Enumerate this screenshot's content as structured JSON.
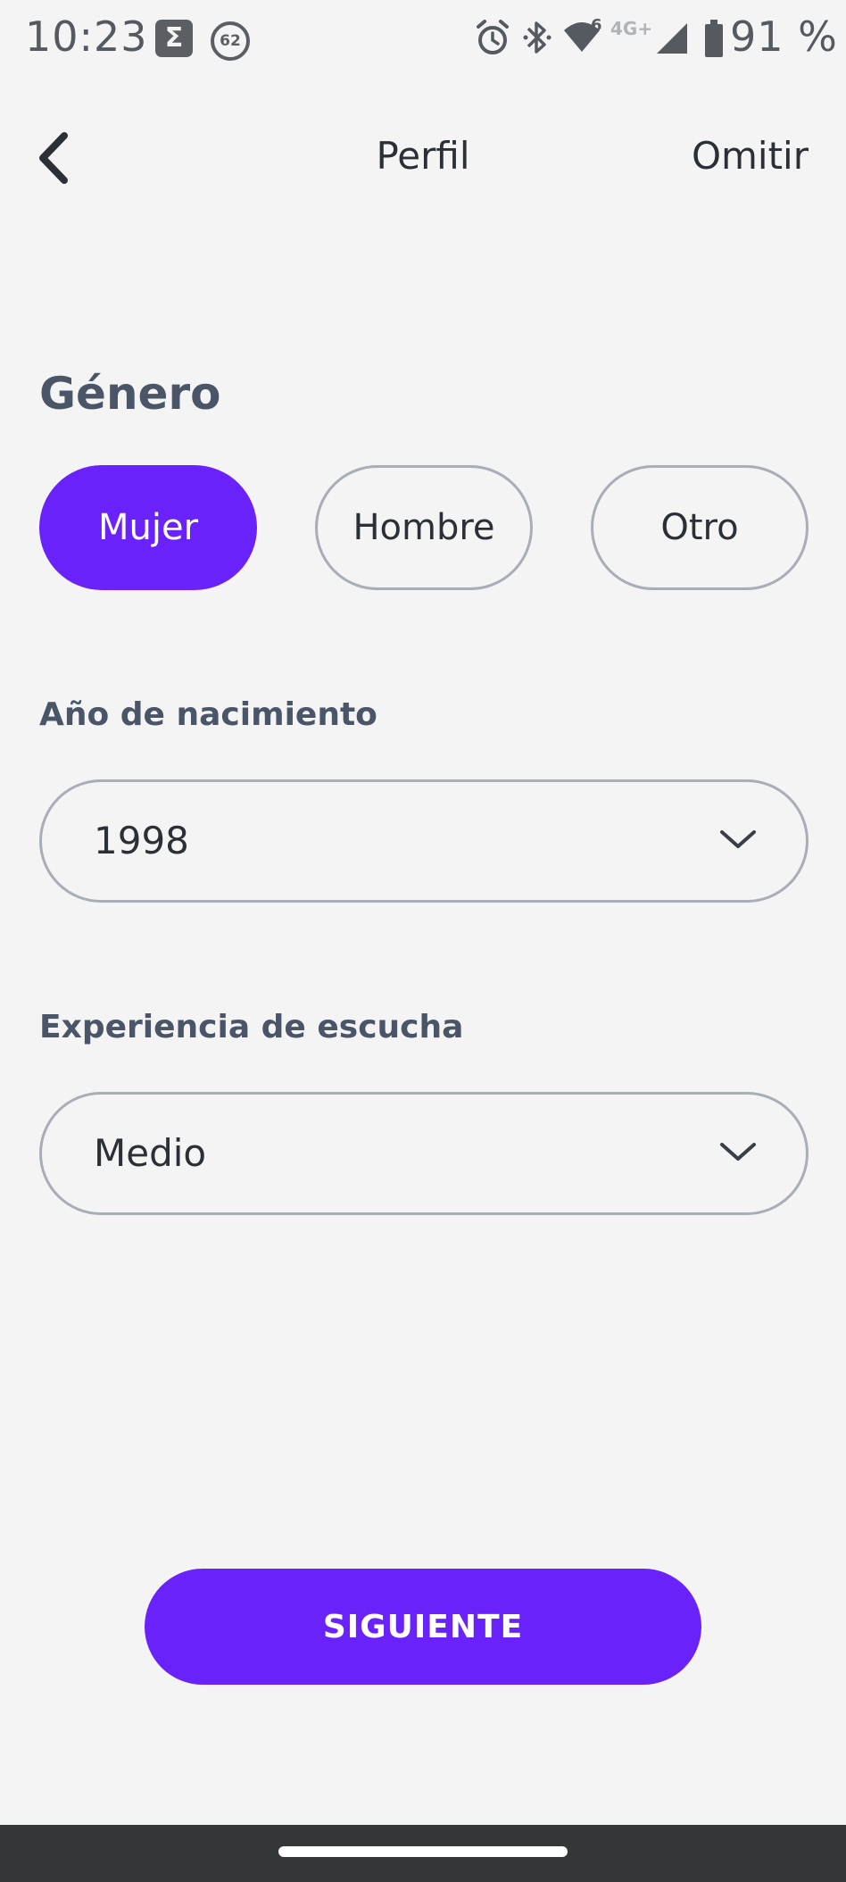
{
  "status_bar": {
    "time": "10:23",
    "sigma_glyph": "Σ",
    "notification_badge": "62",
    "network_type": "4G+",
    "wifi_superscript": "6",
    "battery_text": "91 %",
    "icons": [
      "alarm-icon",
      "bluetooth-icon",
      "wifi-icon",
      "cell-signal-icon",
      "battery-icon"
    ]
  },
  "header": {
    "back_icon": "chevron-left-icon",
    "title": "Perfil",
    "skip_label": "Omitir"
  },
  "gender": {
    "title": "Género",
    "options": [
      {
        "label": "Mujer",
        "selected": true
      },
      {
        "label": "Hombre",
        "selected": false
      },
      {
        "label": "Otro",
        "selected": false
      }
    ]
  },
  "birth_year": {
    "label": "Año de nacimiento",
    "value": "1998"
  },
  "listening_experience": {
    "label": "Experiencia de escucha",
    "value": "Medio"
  },
  "actions": {
    "next_label": "SIGUIENTE"
  },
  "colors": {
    "accent": "#6a22fb",
    "background": "#f4f4f5",
    "label": "#4a5568",
    "border": "#a9adb6",
    "nav_bar": "#333738"
  }
}
